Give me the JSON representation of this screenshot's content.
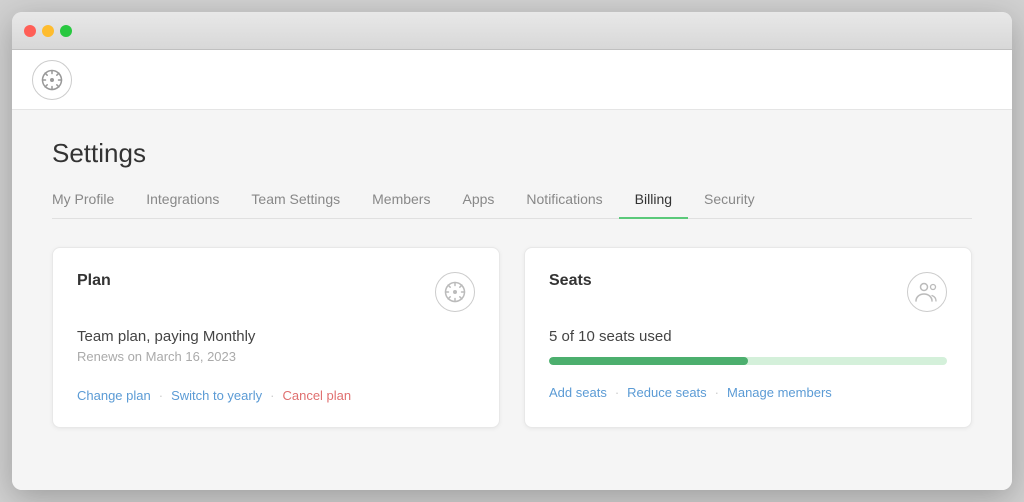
{
  "window": {
    "traffic": [
      "close",
      "minimize",
      "maximize"
    ]
  },
  "header": {
    "logo_icon": "⊙"
  },
  "page": {
    "title": "Settings",
    "tabs": [
      {
        "id": "my-profile",
        "label": "My Profile",
        "active": false
      },
      {
        "id": "integrations",
        "label": "Integrations",
        "active": false
      },
      {
        "id": "team-settings",
        "label": "Team Settings",
        "active": false
      },
      {
        "id": "members",
        "label": "Members",
        "active": false
      },
      {
        "id": "apps",
        "label": "Apps",
        "active": false
      },
      {
        "id": "notifications",
        "label": "Notifications",
        "active": false
      },
      {
        "id": "billing",
        "label": "Billing",
        "active": true
      },
      {
        "id": "security",
        "label": "Security",
        "active": false
      }
    ]
  },
  "plan_card": {
    "title": "Plan",
    "plan_name": "Team plan, paying Monthly",
    "renew_date": "Renews on March 16, 2023",
    "actions": [
      {
        "label": "Change plan",
        "type": "link"
      },
      {
        "label": "Switch to yearly",
        "type": "link"
      },
      {
        "label": "Cancel plan",
        "type": "danger"
      }
    ]
  },
  "seats_card": {
    "title": "Seats",
    "seats_used_label": "5 of 10 seats used",
    "seats_used": 5,
    "seats_total": 10,
    "progress_percent": 50,
    "actions": [
      {
        "label": "Add seats",
        "type": "link"
      },
      {
        "label": "Reduce seats",
        "type": "link"
      },
      {
        "label": "Manage members",
        "type": "link"
      }
    ]
  }
}
